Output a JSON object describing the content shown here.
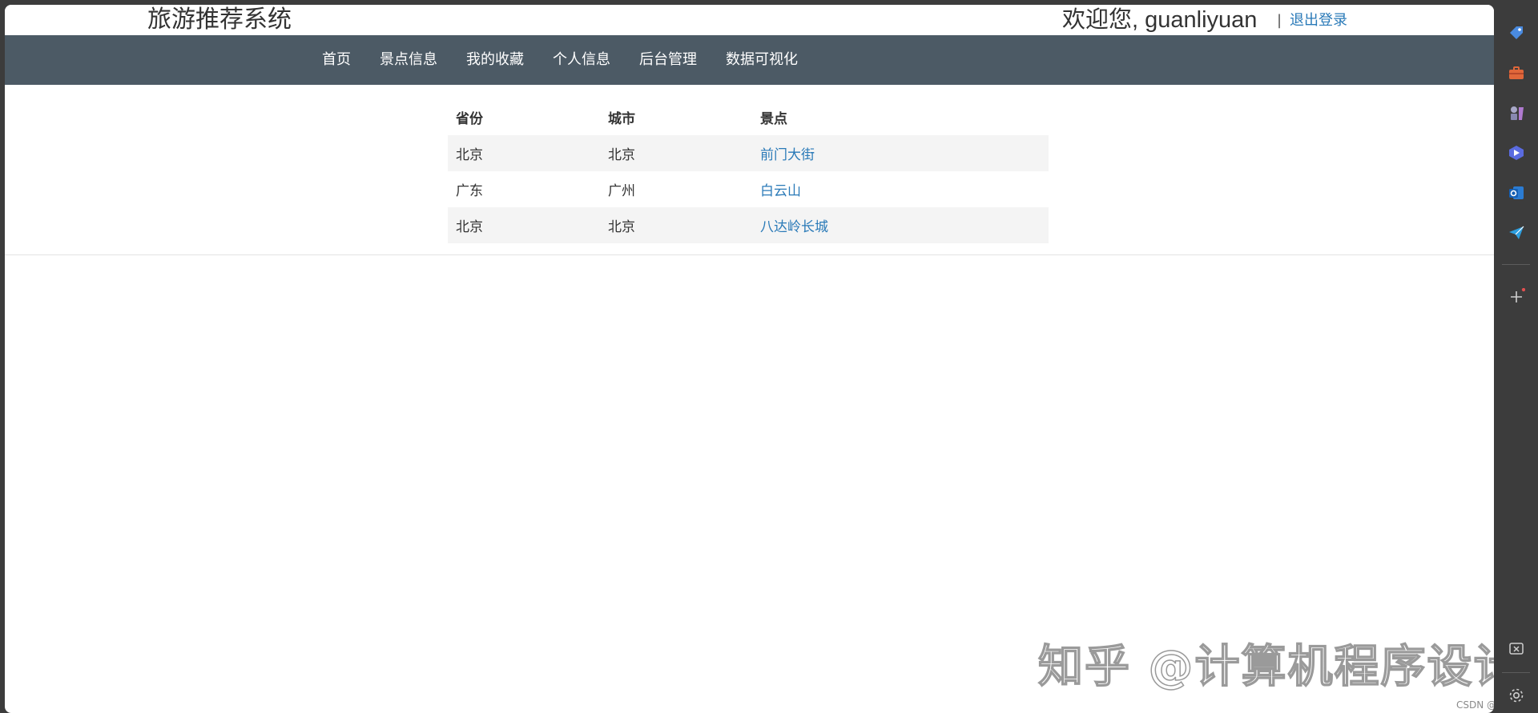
{
  "header": {
    "site_title": "旅游推荐系统",
    "welcome": "欢迎您, guanliyuan",
    "separator": "|",
    "logout": "退出登录"
  },
  "nav": {
    "items": [
      "首页",
      "景点信息",
      "我的收藏",
      "个人信息",
      "后台管理",
      "数据可视化"
    ]
  },
  "table": {
    "headers": [
      "省份",
      "城市",
      "景点"
    ],
    "rows": [
      {
        "province": "北京",
        "city": "北京",
        "spot": "前门大街"
      },
      {
        "province": "广东",
        "city": "广州",
        "spot": "白云山"
      },
      {
        "province": "北京",
        "city": "北京",
        "spot": "八达岭长城"
      }
    ]
  },
  "overlay": {
    "watermark": "知乎 @计算机程序设计",
    "csdn": "CSDN @汤姆"
  },
  "sidebar": {
    "icons": [
      "tag-icon",
      "toolbox-icon",
      "chess-icon",
      "copilot-icon",
      "outlook-icon",
      "send-icon",
      "add-icon",
      "screenshot-icon",
      "settings-icon"
    ]
  },
  "colors": {
    "navbar": "#4c5a65",
    "link": "#2a7ab8",
    "stripe": "#f4f4f4"
  }
}
